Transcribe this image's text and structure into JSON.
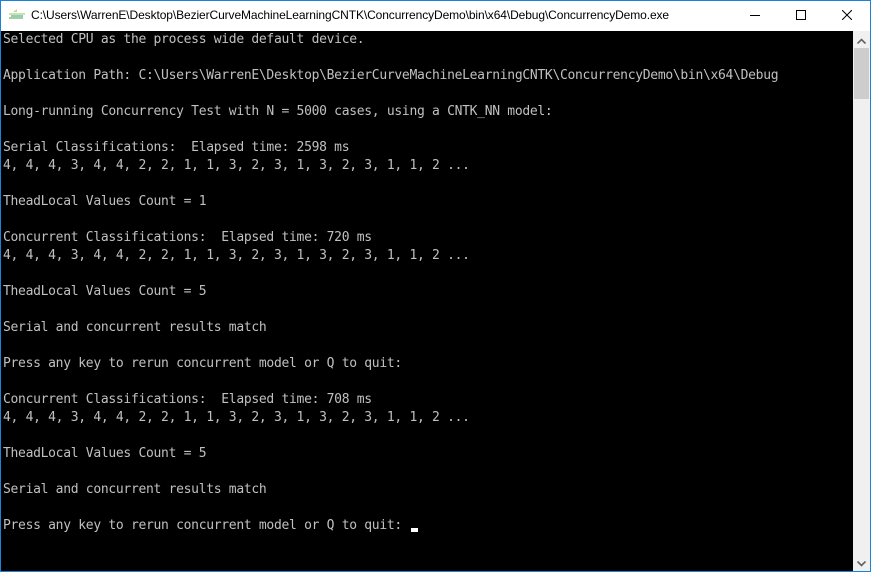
{
  "window": {
    "title": "C:\\Users\\WarrenE\\Desktop\\BezierCurveMachineLearningCNTK\\ConcurrencyDemo\\bin\\x64\\Debug\\ConcurrencyDemo.exe",
    "app_icon": "console-app-icon",
    "controls": {
      "minimize": "minimize-icon",
      "maximize": "maximize-icon",
      "close": "close-icon"
    },
    "border_color": "#1883d7"
  },
  "console": {
    "background": "#000000",
    "foreground": "#c0c0c0",
    "lines": [
      "Selected CPU as the process wide default device.",
      "",
      "Application Path: C:\\Users\\WarrenE\\Desktop\\BezierCurveMachineLearningCNTK\\ConcurrencyDemo\\bin\\x64\\Debug",
      "",
      "Long-running Concurrency Test with N = 5000 cases, using a CNTK_NN model:",
      "",
      "Serial Classifications:  Elapsed time: 2598 ms",
      "4, 4, 4, 3, 4, 4, 2, 2, 1, 1, 3, 2, 3, 1, 3, 2, 3, 1, 1, 2 ...",
      "",
      "TheadLocal Values Count = 1",
      "",
      "Concurrent Classifications:  Elapsed time: 720 ms",
      "4, 4, 4, 3, 4, 4, 2, 2, 1, 1, 3, 2, 3, 1, 3, 2, 3, 1, 1, 2 ...",
      "",
      "TheadLocal Values Count = 5",
      "",
      "Serial and concurrent results match",
      "",
      "Press any key to rerun concurrent model or Q to quit:",
      "",
      "Concurrent Classifications:  Elapsed time: 708 ms",
      "4, 4, 4, 3, 4, 4, 2, 2, 1, 1, 3, 2, 3, 1, 3, 2, 3, 1, 1, 2 ...",
      "",
      "TheadLocal Values Count = 5",
      "",
      "Serial and concurrent results match",
      "",
      "Press any key to rerun concurrent model or Q to quit: "
    ]
  },
  "scrollbar": {
    "up_icon": "chevron-up-icon",
    "down_icon": "chevron-down-icon"
  }
}
